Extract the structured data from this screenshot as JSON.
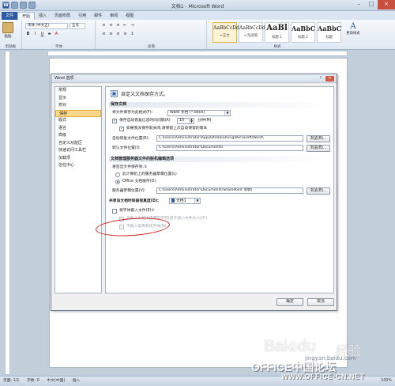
{
  "window": {
    "title": "文档1 - Microsoft Word",
    "app_icon": "W",
    "minimize": "–",
    "maximize": "□",
    "close": "×"
  },
  "ribbon_tabs": [
    "文件",
    "开始",
    "插入",
    "页面布局",
    "引用",
    "邮件",
    "审阅",
    "视图"
  ],
  "ribbon": {
    "paste_label": "粘贴",
    "font_name": "宋体 (中文正)",
    "font_size": "五号",
    "group_clipboard": "剪贴板",
    "group_font": "字体",
    "group_paragraph": "段落",
    "group_styles": "样式",
    "styles": [
      {
        "preview": "AaBbCcDd",
        "label": "↵正文"
      },
      {
        "preview": "AaBbCcDd",
        "label": "↵无间隔"
      },
      {
        "preview": "AaBl",
        "label": "标题 1"
      },
      {
        "preview": "AaBbC",
        "label": "标题 2"
      },
      {
        "preview": "AaBbC",
        "label": "标题"
      }
    ],
    "change_styles": "更改样式"
  },
  "dialog": {
    "title": "Word 选项",
    "help": "?",
    "close": "×",
    "nav_items": [
      "常规",
      "显示",
      "校对",
      "保存",
      "版式",
      "语言",
      "高级",
      "自定义功能区",
      "快速访问工具栏",
      "加载项",
      "信任中心"
    ],
    "active_nav": "保存",
    "heading": "自定义文档保存方式。",
    "save_section": "保存文档",
    "save_format_label": "将文件保存为此格式(F):",
    "save_format_value": "Word 文档 (*.docx)",
    "autorecover_label": "保存自动恢复信息时间间隔(A)",
    "autorecover_minutes": "10",
    "minutes_unit": "分钟(M)",
    "keep_last_label": "如果我没保存就关闭,请保留上次自动保留的版本",
    "autorecover_location_label": "自动恢复文件位置(R):",
    "autorecover_location_value": "C:\\Users\\Administrator\\AppData\\Roaming\\Microsoft\\Word\\",
    "default_location_label": "默认文件位置(I):",
    "default_location_value": "C:\\Users\\Administrator\\Documents\\",
    "browse_label": "浏览(B)...",
    "offline_section": "文档管理服务器文件的脱机编辑选项",
    "checked_out_label": "将签出文件保存到:①",
    "server_drafts_option": "此计算机上的服务器草稿位置(L)",
    "office_cache_option": "Office 文档缓存(O)",
    "server_drafts_location_label": "服务器草稿位置(V):",
    "server_drafts_location_value": "C:\\Users\\Administrator\\Documents\\SharePoint 草稿\\",
    "fidelity_label": "共享该文档时保留保真度(D):",
    "fidelity_value": "文档1",
    "embed_fonts_label": "将字体嵌入文件(E)①",
    "embed_used_chars_label": "仅嵌入文档中使用的字符(适于减小文件大小)(C)",
    "no_common_fonts_label": "不嵌入常用系统字体(N)",
    "ok_label": "确定",
    "cancel_label": "取消"
  },
  "status": {
    "page": "页面: 1/1",
    "words": "字数: 0",
    "lang": "中文(中国)",
    "mode": "插入",
    "zoom": "100%"
  },
  "watermark": {
    "baidu": "Bai",
    "paw": "♣",
    "du": "du",
    "jingyan": "经验",
    "jingyan_sub": "jingyan.baidu.com",
    "office": "OFFICE中国论坛",
    "url": "WWW.OFFICE-CN.NET"
  }
}
